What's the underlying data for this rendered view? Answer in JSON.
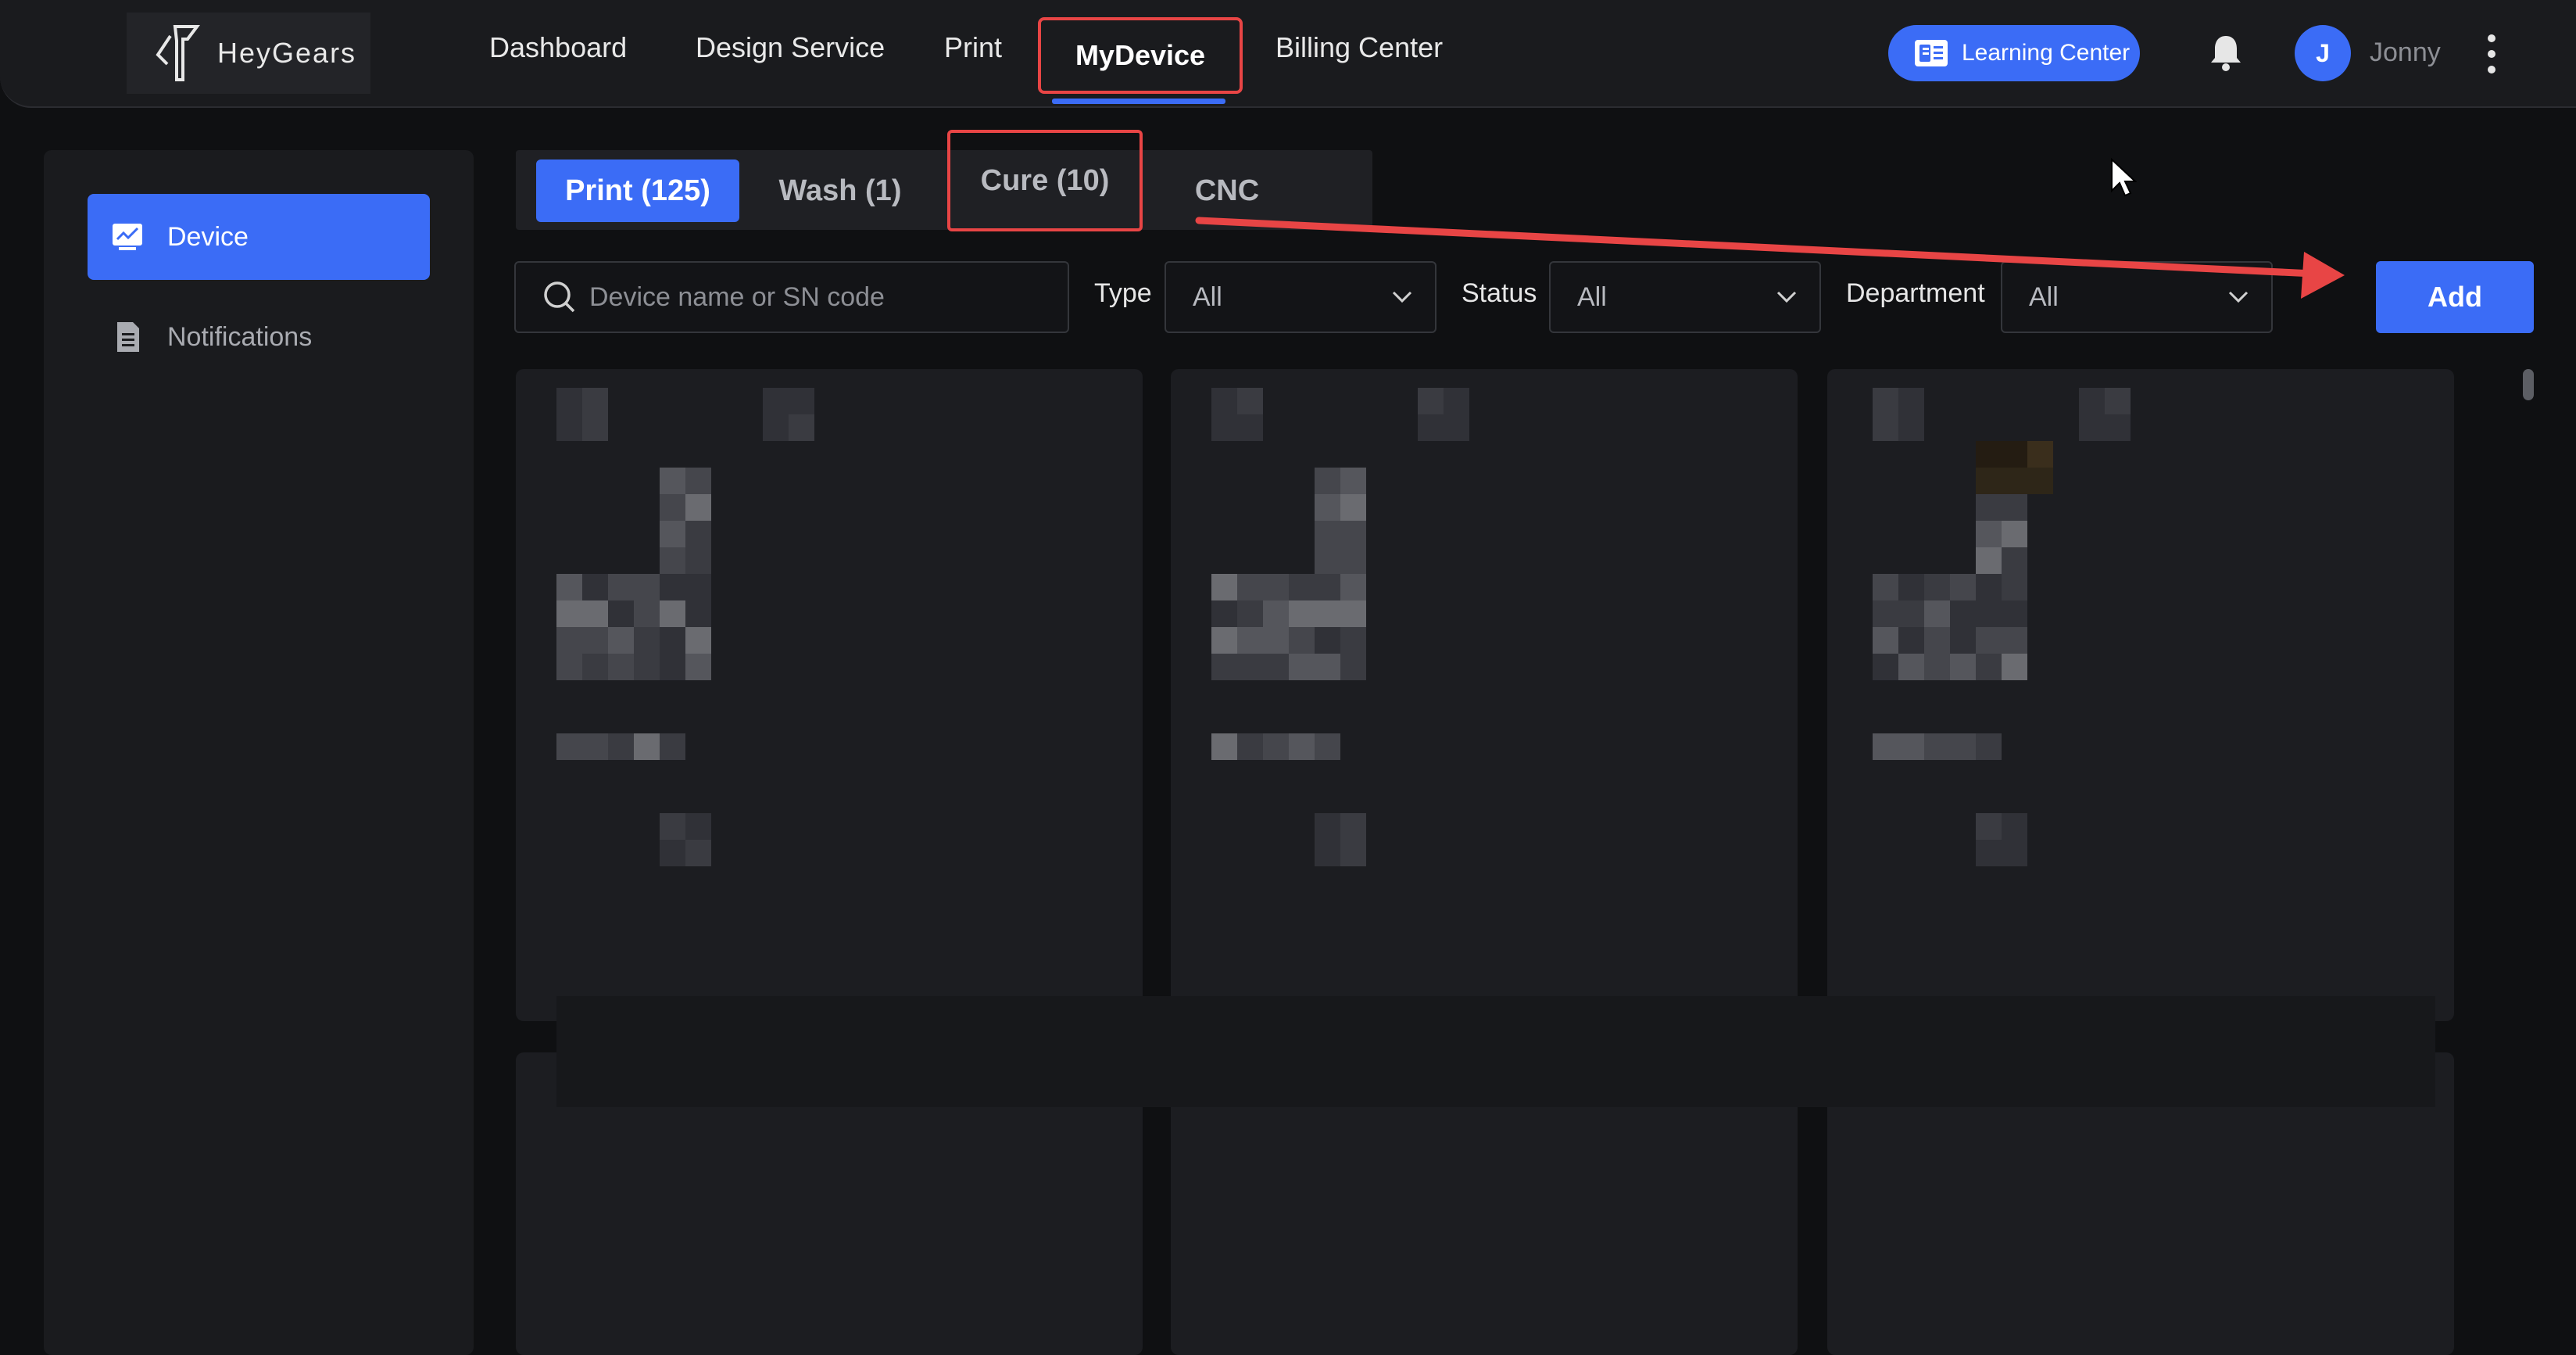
{
  "logo": {
    "text": "HeyGears"
  },
  "nav": {
    "items": [
      "Dashboard",
      "Design Service",
      "Print",
      "MyDevice",
      "Billing Center"
    ],
    "active": "MyDevice"
  },
  "header": {
    "learning_center": "Learning Center",
    "user_initial": "J",
    "user_name": "Jonny"
  },
  "sidebar": {
    "items": [
      {
        "label": "Device",
        "icon": "monitor-chart-icon",
        "active": true
      },
      {
        "label": "Notifications",
        "icon": "document-list-icon",
        "active": false
      }
    ]
  },
  "tabs": [
    {
      "label": "Print (125)",
      "active": true
    },
    {
      "label": "Wash (1)",
      "active": false
    },
    {
      "label": "Cure (10)",
      "active": false
    },
    {
      "label": "CNC",
      "active": false
    }
  ],
  "filters": {
    "search_placeholder": "Device name or SN code",
    "type_label": "Type",
    "type_value": "All",
    "status_label": "Status",
    "status_value": "All",
    "department_label": "Department",
    "department_value": "All",
    "add_label": "Add"
  },
  "colors": {
    "accent": "#3b6cf6",
    "annotation": "#e84545",
    "background": "#0f1012",
    "panel": "#1a1b1e"
  }
}
